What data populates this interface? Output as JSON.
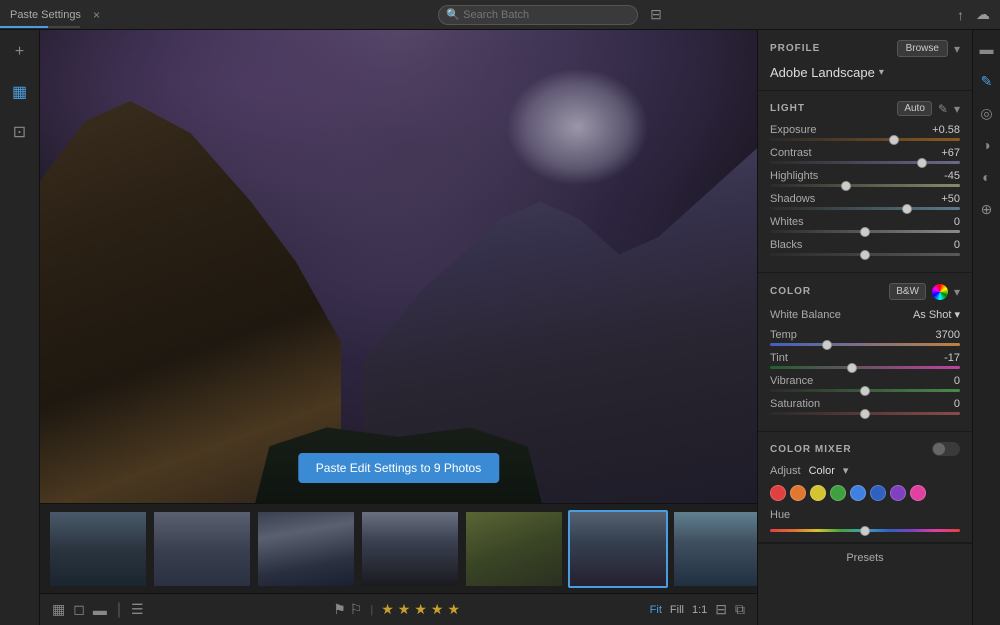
{
  "topbar": {
    "paste_settings_label": "Paste Settings",
    "close_label": "×",
    "search_placeholder": "Search Batch",
    "upload_icon": "↑",
    "cloud_icon": "☁"
  },
  "left_sidebar": {
    "icons": [
      {
        "name": "add-icon",
        "symbol": "+"
      },
      {
        "name": "grid-icon",
        "symbol": "▦"
      },
      {
        "name": "crop-icon",
        "symbol": "⊡"
      }
    ]
  },
  "tooltip": {
    "text": "Paste Edit Settings to 9 Photos"
  },
  "filmstrip": {
    "thumbnails": [
      {
        "id": 1,
        "active": false,
        "bg_class": "thumb-bg-1"
      },
      {
        "id": 2,
        "active": false,
        "bg_class": "thumb-bg-2"
      },
      {
        "id": 3,
        "active": false,
        "bg_class": "thumb-bg-3"
      },
      {
        "id": 4,
        "active": false,
        "bg_class": "thumb-bg-4"
      },
      {
        "id": 5,
        "active": false,
        "bg_class": "thumb-bg-5"
      },
      {
        "id": 6,
        "active": true,
        "bg_class": "thumb-bg-6"
      },
      {
        "id": 7,
        "active": false,
        "bg_class": "thumb-bg-7"
      },
      {
        "id": 8,
        "active": false,
        "bg_class": "thumb-bg-8"
      },
      {
        "id": 9,
        "active": false,
        "bg_class": "thumb-bg-9"
      }
    ]
  },
  "bottom_bar": {
    "grid_icon": "▦",
    "list_icon": "☰",
    "flag_icon": "⚑",
    "stars": [
      "★",
      "★",
      "★",
      "★",
      "★"
    ],
    "zoom_fit": "Fit",
    "zoom_fill": "Fill",
    "zoom_1_1": "1:1",
    "compare_icon": "⊟",
    "before_after_icon": "⧉"
  },
  "right_panel": {
    "profile": {
      "section_title": "PROFILE",
      "browse_label": "Browse",
      "chevron_down": "▾",
      "name": "Adobe Landscape",
      "name_chevron": "▾"
    },
    "light": {
      "section_title": "LIGHT",
      "auto_label": "Auto",
      "sliders": [
        {
          "label": "Exposure",
          "value": "+0.58",
          "percent": 65
        },
        {
          "label": "Contrast",
          "value": "+67",
          "percent": 80
        },
        {
          "label": "Highlights",
          "value": "-45",
          "percent": 40
        },
        {
          "label": "Shadows",
          "value": "+50",
          "percent": 72
        },
        {
          "label": "Whites",
          "value": "0",
          "percent": 50
        },
        {
          "label": "Blacks",
          "value": "0",
          "percent": 50
        }
      ]
    },
    "color": {
      "section_title": "COLOR",
      "bw_label": "B&W",
      "white_balance_label": "White Balance",
      "white_balance_value": "As Shot",
      "chevron": "▾",
      "sliders": [
        {
          "label": "Temp",
          "value": "3700",
          "percent": 30,
          "track": "track-temp"
        },
        {
          "label": "Tint",
          "value": "-17",
          "percent": 43,
          "track": "track-tint"
        },
        {
          "label": "Vibrance",
          "value": "0",
          "percent": 50,
          "track": "track-vibrance"
        },
        {
          "label": "Saturation",
          "value": "0",
          "percent": 50,
          "track": "track-saturation"
        }
      ]
    },
    "color_mixer": {
      "section_title": "COLOR MIXER",
      "adjust_label": "Adjust",
      "color_label": "Color",
      "chevron": "▾",
      "hue_label": "Hue",
      "dots": [
        {
          "color": "#e04040",
          "name": "red"
        },
        {
          "color": "#e07830",
          "name": "orange"
        },
        {
          "color": "#d4c430",
          "name": "yellow"
        },
        {
          "color": "#40a040",
          "name": "green"
        },
        {
          "color": "#4080e0",
          "name": "aqua"
        },
        {
          "color": "#3060c0",
          "name": "blue"
        },
        {
          "color": "#8040c0",
          "name": "purple"
        },
        {
          "color": "#e040a0",
          "name": "magenta"
        }
      ]
    },
    "presets": {
      "label": "Presets"
    }
  },
  "right_icons": [
    {
      "name": "histogram-icon",
      "symbol": "▬",
      "active": false
    },
    {
      "name": "edit-icon",
      "symbol": "✎",
      "active": true
    },
    {
      "name": "detail-icon",
      "symbol": "◎",
      "active": false
    },
    {
      "name": "lens-icon",
      "symbol": "◑",
      "active": false
    },
    {
      "name": "color-grading-icon",
      "symbol": "◐",
      "active": false
    },
    {
      "name": "calibration-icon",
      "symbol": "⊕",
      "active": false
    }
  ]
}
